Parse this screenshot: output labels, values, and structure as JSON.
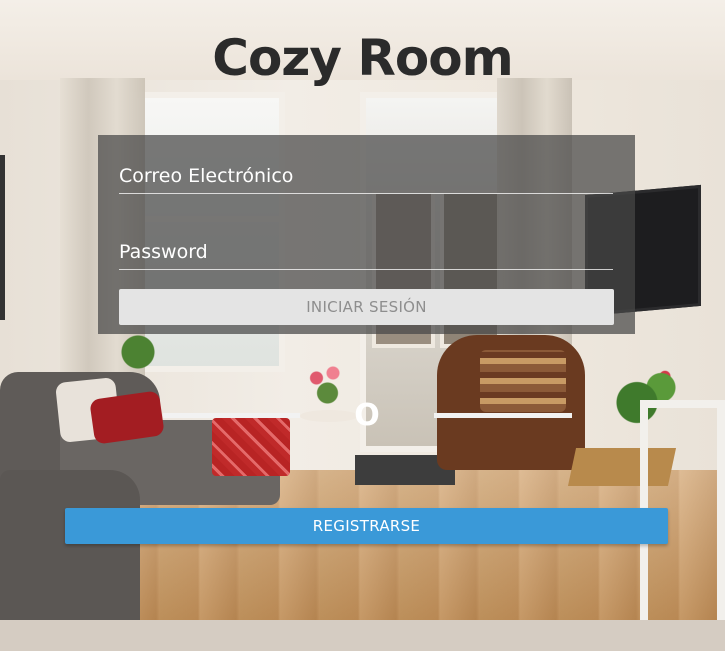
{
  "app": {
    "title": "Cozy Room"
  },
  "login": {
    "email_placeholder": "Correo Electrónico",
    "password_placeholder": "Password",
    "submit_label": "INICIAR SESIÓN"
  },
  "divider": {
    "text": "O"
  },
  "register": {
    "label": "REGISTRARSE"
  },
  "colors": {
    "title": "#2b2b2b",
    "panel_overlay": "rgba(70,70,70,0.72)",
    "login_button_bg": "#e4e4e4",
    "login_button_text": "#8e8e8e",
    "register_button_bg": "#3a99d8",
    "register_button_text": "#ffffff"
  }
}
